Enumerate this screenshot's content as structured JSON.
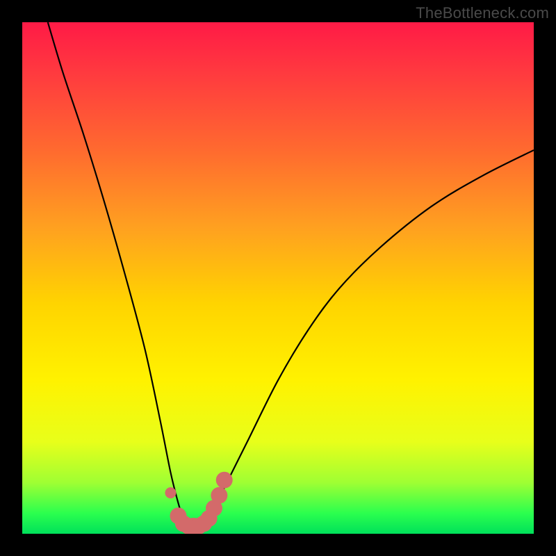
{
  "watermark": "TheBottleneck.com",
  "chart_data": {
    "type": "line",
    "title": "",
    "xlabel": "",
    "ylabel": "",
    "xlim": [
      0,
      100
    ],
    "ylim": [
      0,
      100
    ],
    "background_gradient_stops": [
      {
        "pos": 0,
        "color": "#ff1a46"
      },
      {
        "pos": 10,
        "color": "#ff3a3f"
      },
      {
        "pos": 25,
        "color": "#ff6a2f"
      },
      {
        "pos": 40,
        "color": "#ffa020"
      },
      {
        "pos": 55,
        "color": "#ffd400"
      },
      {
        "pos": 70,
        "color": "#fff200"
      },
      {
        "pos": 82,
        "color": "#e8ff1a"
      },
      {
        "pos": 90,
        "color": "#9fff33"
      },
      {
        "pos": 96,
        "color": "#2bff4e"
      },
      {
        "pos": 100,
        "color": "#00e05a"
      }
    ],
    "series": [
      {
        "name": "bottleneck-curve",
        "color": "#000000",
        "stroke_width": 2.2,
        "x": [
          5,
          8,
          12,
          16,
          20,
          24,
          27,
          29,
          30.5,
          31.5,
          32.5,
          34,
          36,
          38,
          40,
          44,
          50,
          56,
          62,
          70,
          80,
          90,
          100
        ],
        "y": [
          100,
          90,
          78,
          65,
          51,
          36,
          22,
          12,
          6,
          3,
          2,
          2,
          3,
          6,
          10,
          18,
          30,
          40,
          48,
          56,
          64,
          70,
          75
        ]
      },
      {
        "name": "highlight-points",
        "color": "#d36a6a",
        "marker": "circle",
        "x": [
          29.0,
          30.5,
          31.5,
          32.5,
          33.5,
          34.5,
          35.5,
          36.5,
          37.5,
          38.5,
          39.5
        ],
        "y": [
          8.0,
          3.5,
          2.0,
          1.5,
          1.5,
          1.5,
          2.0,
          3.0,
          5.0,
          7.5,
          10.5
        ]
      }
    ],
    "annotations": []
  }
}
